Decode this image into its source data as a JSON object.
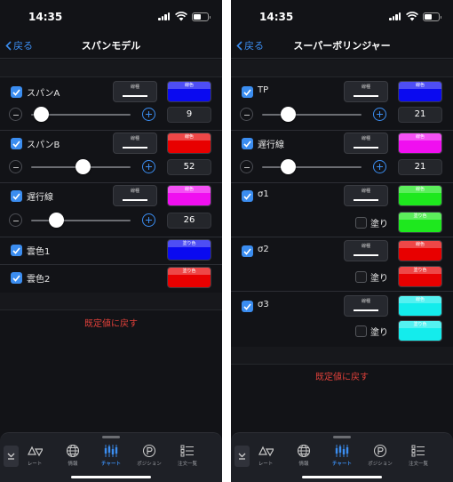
{
  "status": {
    "time": "14:35"
  },
  "nav": {
    "back_label": "戻る"
  },
  "labels": {
    "line_type": "線種",
    "line_color": "線色",
    "fill_color": "塗り色",
    "fill": "塗り"
  },
  "left": {
    "title": "スパンモデル",
    "items": [
      {
        "label": "スパンA",
        "checked": true,
        "color": "#0a0af0",
        "value": "9",
        "slider": 0.1
      },
      {
        "label": "スパンB",
        "checked": true,
        "color": "#e80000",
        "value": "52",
        "slider": 0.52
      },
      {
        "label": "遅行線",
        "checked": true,
        "color": "#f00ff0",
        "value": "26",
        "slider": 0.25
      }
    ],
    "clouds": [
      {
        "label": "雲色1",
        "checked": true,
        "color": "#0a0af0"
      },
      {
        "label": "雲色2",
        "checked": true,
        "color": "#e80000"
      }
    ],
    "reset_label": "既定値に戻す"
  },
  "right": {
    "title": "スーパーボリンジャー",
    "items": [
      {
        "label": "TP",
        "checked": true,
        "color": "#0a0af0",
        "value": "21",
        "slider": 0.26
      },
      {
        "label": "遅行線",
        "checked": true,
        "color": "#f00ff0",
        "value": "21",
        "slider": 0.26
      }
    ],
    "sigmas": [
      {
        "label": "σ1",
        "checked": true,
        "line_color": "#1ee81e",
        "fill_checked": false,
        "fill_color": "#1ee81e"
      },
      {
        "label": "σ2",
        "checked": true,
        "line_color": "#e80000",
        "fill_checked": false,
        "fill_color": "#e80000"
      },
      {
        "label": "σ3",
        "checked": true,
        "line_color": "#14ecec",
        "fill_checked": false,
        "fill_color": "#14ecec"
      }
    ],
    "reset_label": "既定値に戻す"
  },
  "tabs": [
    {
      "label": "レート",
      "icon": "rate-icon",
      "active": false
    },
    {
      "label": "情報",
      "icon": "globe-icon",
      "active": false
    },
    {
      "label": "チャート",
      "icon": "candlestick-chart-icon",
      "active": true
    },
    {
      "label": "ポジション",
      "icon": "position-icon",
      "active": false
    },
    {
      "label": "注文一覧",
      "icon": "order-list-icon",
      "active": false
    }
  ],
  "colors": {
    "accent": "#3b8df0",
    "reset": "#e0403a",
    "background": "#121317"
  }
}
